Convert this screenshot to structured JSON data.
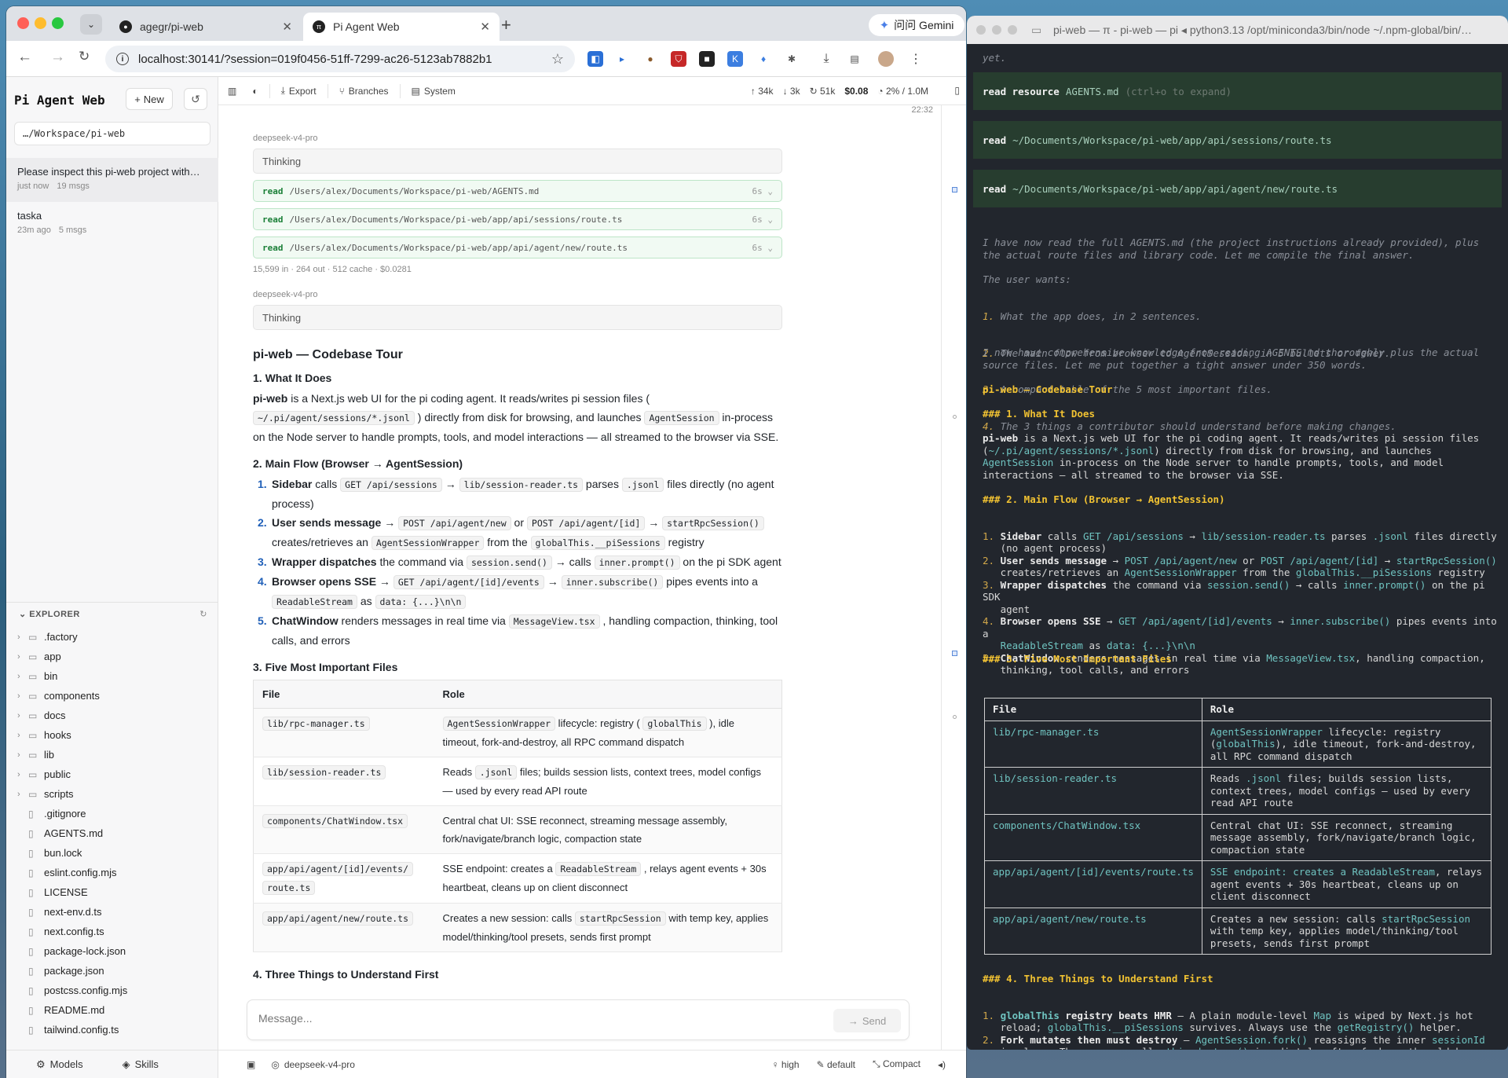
{
  "browser": {
    "tabs": [
      {
        "label": "agegr/pi-web",
        "fav": "github-icon"
      },
      {
        "label": "Pi Agent Web",
        "fav": "pi-icon"
      }
    ],
    "gemini_label": "问问 Gemini",
    "url": "localhost:30141/?session=019f0456-51ff-7299-ac26-5123ab7882b1"
  },
  "sidebar": {
    "brand": "Pi Agent Web",
    "new_label": "New",
    "cwd": "…/Workspace/pi-web",
    "sessions": [
      {
        "title": "Please inspect this pi-web project with…",
        "time": "just now",
        "msgs": "19 msgs"
      },
      {
        "title": "taska",
        "time": "23m ago",
        "msgs": "5 msgs"
      }
    ],
    "explorer_label": "EXPLORER",
    "tree": [
      {
        "name": ".factory",
        "type": "folder"
      },
      {
        "name": "app",
        "type": "folder"
      },
      {
        "name": "bin",
        "type": "folder"
      },
      {
        "name": "components",
        "type": "folder"
      },
      {
        "name": "docs",
        "type": "folder"
      },
      {
        "name": "hooks",
        "type": "folder"
      },
      {
        "name": "lib",
        "type": "folder"
      },
      {
        "name": "public",
        "type": "folder"
      },
      {
        "name": "scripts",
        "type": "folder"
      },
      {
        "name": ".gitignore",
        "type": "file"
      },
      {
        "name": "AGENTS.md",
        "type": "file"
      },
      {
        "name": "bun.lock",
        "type": "file"
      },
      {
        "name": "eslint.config.mjs",
        "type": "file"
      },
      {
        "name": "LICENSE",
        "type": "file"
      },
      {
        "name": "next-env.d.ts",
        "type": "file"
      },
      {
        "name": "next.config.ts",
        "type": "file"
      },
      {
        "name": "package-lock.json",
        "type": "file"
      },
      {
        "name": "package.json",
        "type": "file"
      },
      {
        "name": "postcss.config.mjs",
        "type": "file"
      },
      {
        "name": "README.md",
        "type": "file"
      },
      {
        "name": "tailwind.config.ts",
        "type": "file"
      }
    ],
    "footer": {
      "models": "Models",
      "skills": "Skills"
    }
  },
  "main": {
    "toolbar": {
      "export": "Export",
      "branches": "Branches",
      "system": "System"
    },
    "stats": {
      "up": "34k",
      "down": "3k",
      "cache": "51k",
      "cost": "$0.08",
      "context": "2% / 1.0M"
    },
    "timestamp": "22:32",
    "model": "deepseek-v4-pro",
    "thinking": "Thinking",
    "tools": [
      {
        "verb": "read",
        "path": "/Users/alex/Documents/Workspace/pi-web/AGENTS.md",
        "dur": "6s"
      },
      {
        "verb": "read",
        "path": "/Users/alex/Documents/Workspace/pi-web/app/api/sessions/route.ts",
        "dur": "6s"
      },
      {
        "verb": "read",
        "path": "/Users/alex/Documents/Workspace/pi-web/app/api/agent/new/route.ts",
        "dur": "6s"
      }
    ],
    "usage": "15,599 in · 264 out · 512 cache · $0.0281",
    "tour_title": "pi-web — Codebase Tour",
    "h_what": "1. What It Does",
    "h_flow": "2. Main Flow (Browser → AgentSession)",
    "h_files": "3. Five Most Important Files",
    "h_three": "4. Three Things to Understand First",
    "table_headers": [
      "File",
      "Role"
    ],
    "composer_placeholder": "Message...",
    "send": "Send",
    "footer": {
      "model": "deepseek-v4-pro",
      "effort": "high",
      "mode": "default",
      "compact": "Compact"
    }
  },
  "terminal": {
    "title": "pi-web — π - pi-web — pi ◂ python3.13 /opt/miniconda3/bin/node ~/.npm-global/bin/…",
    "first_line": "yet.",
    "blocks": [
      {
        "verb": "read resource",
        "path": "AGENTS.md",
        "hint": "(ctrl+o to expand)"
      },
      {
        "verb": "read",
        "path": "~/Documents/Workspace/pi-web/app/api/sessions/route.ts",
        "hint": ""
      },
      {
        "verb": "read",
        "path": "~/Documents/Workspace/pi-web/app/api/agent/new/route.ts",
        "hint": ""
      }
    ],
    "think1": "I have now read the full AGENTS.md (the project instructions already provided), plus the actual route files and library code. Let me compile the final answer.",
    "think2": "The user wants:",
    "wants": [
      "What the app does, in 2 sentences.",
      "The main flow from browser to AgentSession, in 5 bullets or fewer.",
      "A compact table of the 5 most important files.",
      "The 3 things a contributor should understand before making changes."
    ],
    "think3": "I now have comprehensive knowledge from reading AGENTS.md thoroughly plus the actual source files. Let me put together a tight answer under 350 words.",
    "tour_title": "pi-web — Codebase Tour",
    "h1": "### 1. What It Does",
    "h2": "### 2. Main Flow (Browser → AgentSession)",
    "h3": "### 3. Five Most Important Files",
    "h4": "### 4. Three Things to Understand First",
    "table_headers": [
      "File",
      "Role"
    ]
  },
  "colors": {
    "accent": "#1f5fb8",
    "tool_green": "#1a7f37",
    "terminal_bg": "#22262d",
    "terminal_yellow": "#f1c232",
    "terminal_cyan": "#6fc3c0"
  }
}
